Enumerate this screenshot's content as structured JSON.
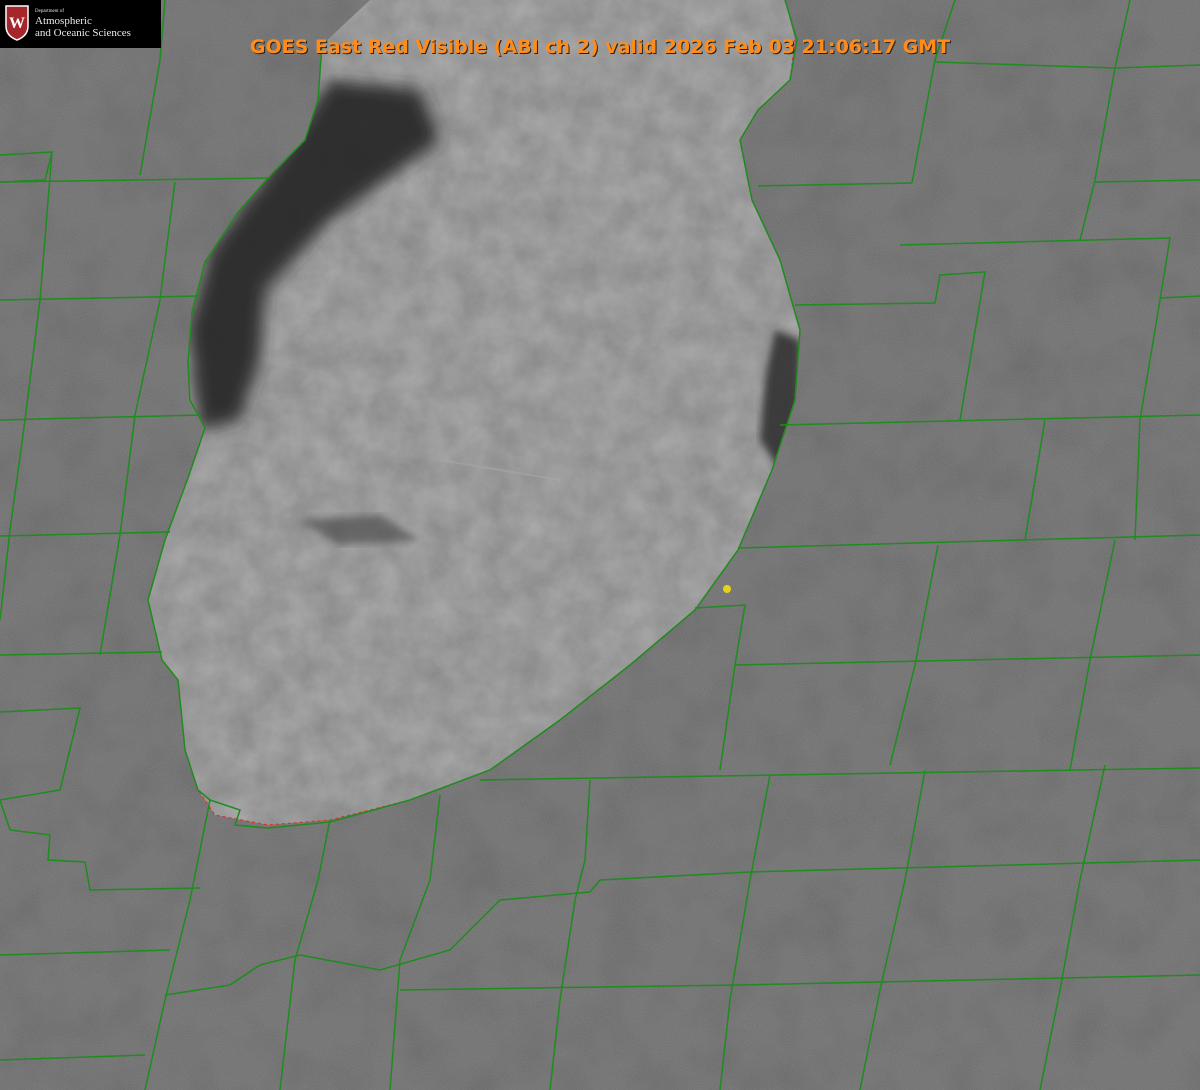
{
  "title": "GOES East Red Visible (ABI ch 2) valid 2026 Feb 03 21:06:17 GMT",
  "logo": {
    "department": "Department of",
    "line1": "Atmospheric",
    "line2": "and Oceanic Sciences",
    "shield_letter": "W"
  },
  "colors": {
    "title": "#ff8c1a",
    "county_lines": "#1e8c1e",
    "lake_outline": "#e03030",
    "marker": "#e6d21e",
    "logo_shield": "#a5272b"
  },
  "marker": {
    "label": "yellow-dot"
  }
}
